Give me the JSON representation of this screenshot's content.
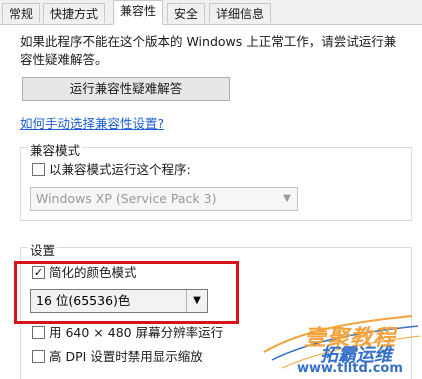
{
  "tabs": [
    "常规",
    "快捷方式",
    "兼容性",
    "安全",
    "详细信息"
  ],
  "active_tab_index": 2,
  "description": "如果此程序不能在这个版本的 Windows 上正常工作，请尝试运行兼容性疑难解答。",
  "description_line1": "如果此程序不能在这个版本的 Windows 上正常工作，请尝试运行兼",
  "description_line2": "容性疑难解答。",
  "troubleshooter_button": "运行兼容性疑难解答",
  "manual_link": "如何手动选择兼容性设置?",
  "compat_mode": {
    "title": "兼容模式",
    "checkbox_label": "以兼容模式运行这个程序:",
    "checked": false,
    "os_select_value": "Windows XP (Service Pack 3)",
    "disabled": true
  },
  "settings": {
    "title": "设置",
    "reduced_color": {
      "label": "简化的颜色模式",
      "checked": true
    },
    "color_select_value": "16 位(65536)色",
    "resolution_640": {
      "label": "用 640 × 480 屏幕分辨率运行",
      "checked": false
    },
    "dpi_scaling": {
      "label": "高 DPI 设置时禁用显示缩放",
      "checked": false
    }
  },
  "watermark": {
    "line1": "壹聚教程",
    "line2": "拓霸运维",
    "url": "www.tlltd.com"
  },
  "colors": {
    "highlight_border": "#d7141a",
    "link": "#1d5fd1",
    "watermark_orange": "#f2a33c",
    "watermark_blue": "#3570c8"
  }
}
